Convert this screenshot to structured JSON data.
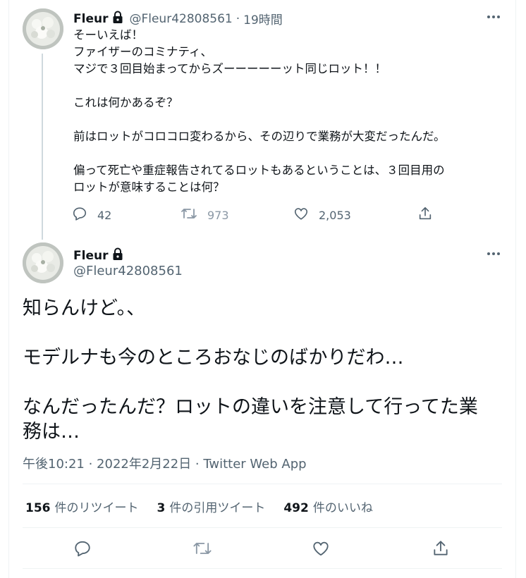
{
  "tweet1": {
    "display_name": "Fleur",
    "handle": "@Fleur42808561",
    "separator": "·",
    "time": "19時間",
    "text": "そーいえば！\nファイザーのコミナティ、\nマジで３回目始まってからズーーーーーット同じロット！！\n\nこれは何かあるぞ？\n\n前はロットがコロコロ変わるから、その辺りで業務が大変だったんだ。\n\n偏って死亡や重症報告されてるロットもあるということは、３回目用の\nロットが意味することは何？",
    "replies": "42",
    "retweets": "973",
    "likes": "2,053"
  },
  "tweet2": {
    "display_name": "Fleur",
    "handle": "@Fleur42808561",
    "text": "知らんけど。、\n\nモデルナも今のところおなじのばかりだわ…\n\nなんだったんだ？ロットの違いを注意して行ってた業\n務は…",
    "meta": "午後10:21 · 2022年2月22日 · Twitter Web App",
    "stats": {
      "retweets_count": "156",
      "retweets_label": "件のリツイート",
      "quotes_count": "3",
      "quotes_label": "件の引用ツイート",
      "likes_count": "492",
      "likes_label": "件のいいね"
    }
  },
  "icons": {
    "lock": "lock-icon",
    "more": "more-icon",
    "reply": "reply-icon",
    "retweet": "retweet-icon",
    "like": "heart-icon",
    "share": "share-icon"
  },
  "colors": {
    "text": "#0f1419",
    "secondary": "#536471",
    "divider": "#eff3f4",
    "thread_line": "#cfd9de"
  }
}
